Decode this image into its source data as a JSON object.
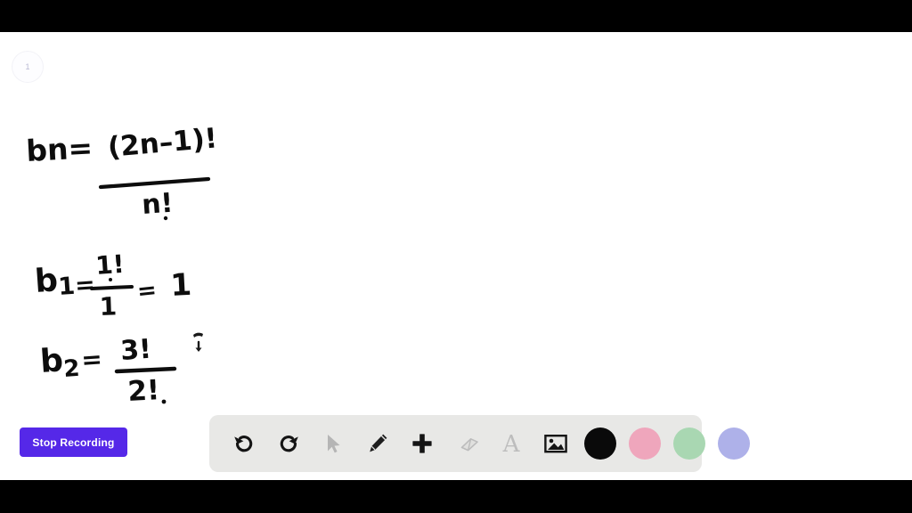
{
  "app": {
    "canvas_bg": "#ffffff",
    "letterbox_color": "#000000"
  },
  "page_badge": {
    "number": "1"
  },
  "whiteboard": {
    "handwriting_lines": [
      {
        "id": "line-1",
        "text": "bn = (2n-1)! / n!",
        "lhs": "bn=",
        "numerator": "(2n-1)!",
        "denominator": "n!"
      },
      {
        "id": "line-2",
        "text": "b1 = 1! / 1 = 1",
        "lhs": "b1=",
        "numerator": "1!",
        "denominator": "1",
        "result": "1"
      },
      {
        "id": "line-3",
        "text": "b2 = 3! / 2! =",
        "lhs": "b2 =",
        "numerator": "3!",
        "denominator": "2!"
      }
    ],
    "cursor": "pen-caret"
  },
  "controls": {
    "stop_recording_label": "Stop Recording",
    "stop_recording_color": "#5528E8"
  },
  "toolbar": {
    "background": "#e8e8e6",
    "tools": [
      {
        "name": "undo-icon",
        "label": "Undo",
        "state": "enabled"
      },
      {
        "name": "redo-icon",
        "label": "Redo",
        "state": "enabled"
      },
      {
        "name": "cursor-icon",
        "label": "Select",
        "state": "disabled"
      },
      {
        "name": "pencil-icon",
        "label": "Pen",
        "state": "enabled"
      },
      {
        "name": "plus-icon",
        "label": "Add",
        "state": "enabled"
      },
      {
        "name": "eraser-icon",
        "label": "Eraser",
        "state": "disabled"
      },
      {
        "name": "text-icon",
        "label": "A",
        "state": "disabled"
      },
      {
        "name": "image-icon",
        "label": "Image",
        "state": "enabled"
      }
    ],
    "swatches": [
      {
        "name": "color-swatch-black",
        "label": "Black",
        "hex": "#0a0a0a",
        "selected": true
      },
      {
        "name": "color-swatch-pink",
        "label": "Pink",
        "hex": "#EFA6BC",
        "selected": false
      },
      {
        "name": "color-swatch-green",
        "label": "Green",
        "hex": "#A9D7B2",
        "selected": false
      },
      {
        "name": "color-swatch-purple",
        "label": "Purple",
        "hex": "#AEB1E9",
        "selected": false
      }
    ]
  }
}
